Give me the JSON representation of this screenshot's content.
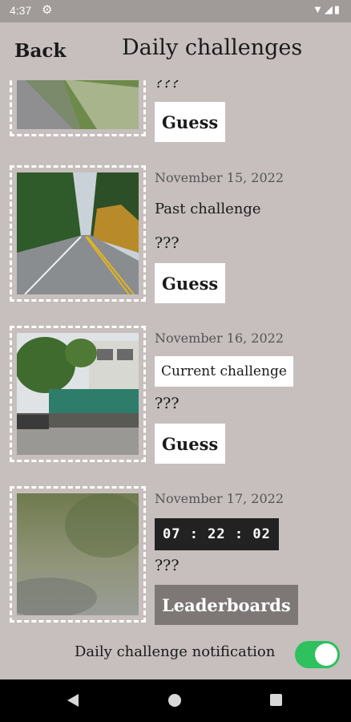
{
  "status_bar": {
    "time": "4:37"
  },
  "header": {
    "back_label": "Back",
    "title": "Daily challenges"
  },
  "challenges": [
    {
      "question": "???",
      "guess_label": "Guess"
    },
    {
      "date": "November 15, 2022",
      "subtitle": "Past challenge",
      "question": "???",
      "guess_label": "Guess"
    },
    {
      "date": "November 16, 2022",
      "subtitle": "Current challenge",
      "question": "???",
      "guess_label": "Guess"
    },
    {
      "date": "November 17, 2022",
      "timer": "07 : 22 : 02",
      "question": "???",
      "leaderboards_label": "Leaderboards"
    }
  ],
  "notification": {
    "label": "Daily challenge notification",
    "enabled": true
  },
  "colors": {
    "background": "#c6bfbd",
    "toggle_on": "#2ec15e",
    "timer_bg": "#222222",
    "leaderboards_bg": "#7d7775"
  }
}
